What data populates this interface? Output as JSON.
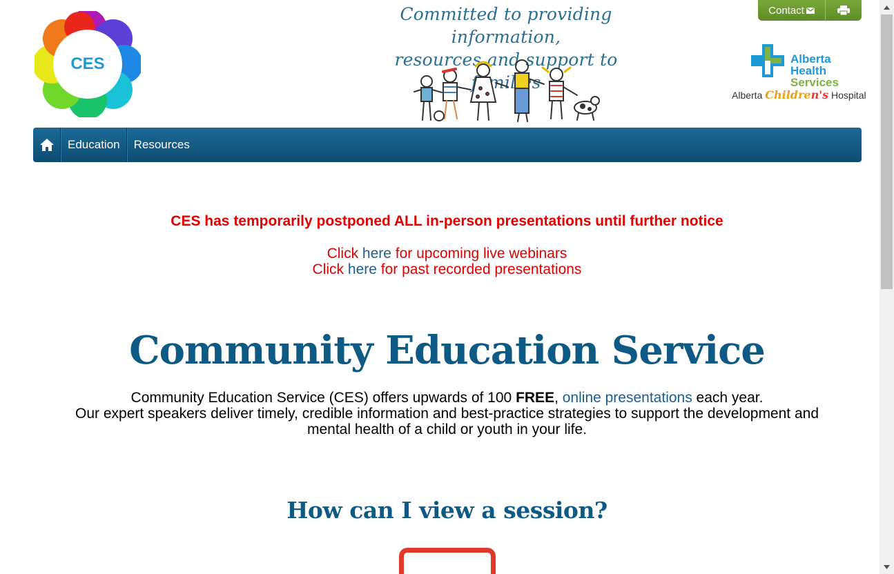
{
  "header": {
    "ces_logo_text": "CES",
    "tagline_line1": "Committed to providing information,",
    "tagline_line2": "resources and support to families",
    "contact_label": "Contact",
    "ahs_line1": "Alberta Health",
    "ahs_line2": "Services",
    "ach_prefix": "Alberta ",
    "ach_children_a": "Childre",
    "ach_children_b": "n's",
    "ach_suffix": " Hospital"
  },
  "nav": {
    "items": [
      {
        "label": "Education"
      },
      {
        "label": "Resources"
      }
    ]
  },
  "notice": {
    "title": "CES has temporarily postponed ALL in-person presentations until further notice",
    "line1_pre": "Click ",
    "line1_link": "here",
    "line1_post": " for upcoming live webinars",
    "line2_pre": "Click ",
    "line2_link": "here",
    "line2_post": " for past recorded presentations"
  },
  "main": {
    "title": "Community Education Service",
    "intro_pre": "Community Education Service (CES) offers upwards of 100 ",
    "intro_bold": "FREE",
    "intro_comma": ", ",
    "intro_link": "online presentations",
    "intro_post": " each year.",
    "intro_line2": "Our expert speakers deliver timely, credible information and best-practice strategies to support the development and mental health of a child or youth in your life.",
    "subtitle": "How can I view a session?"
  },
  "colors": {
    "brand_blue": "#0d5a85",
    "notice_red": "#e00000",
    "contact_green": "#6a9a2e",
    "video_red": "#e03a2a"
  }
}
